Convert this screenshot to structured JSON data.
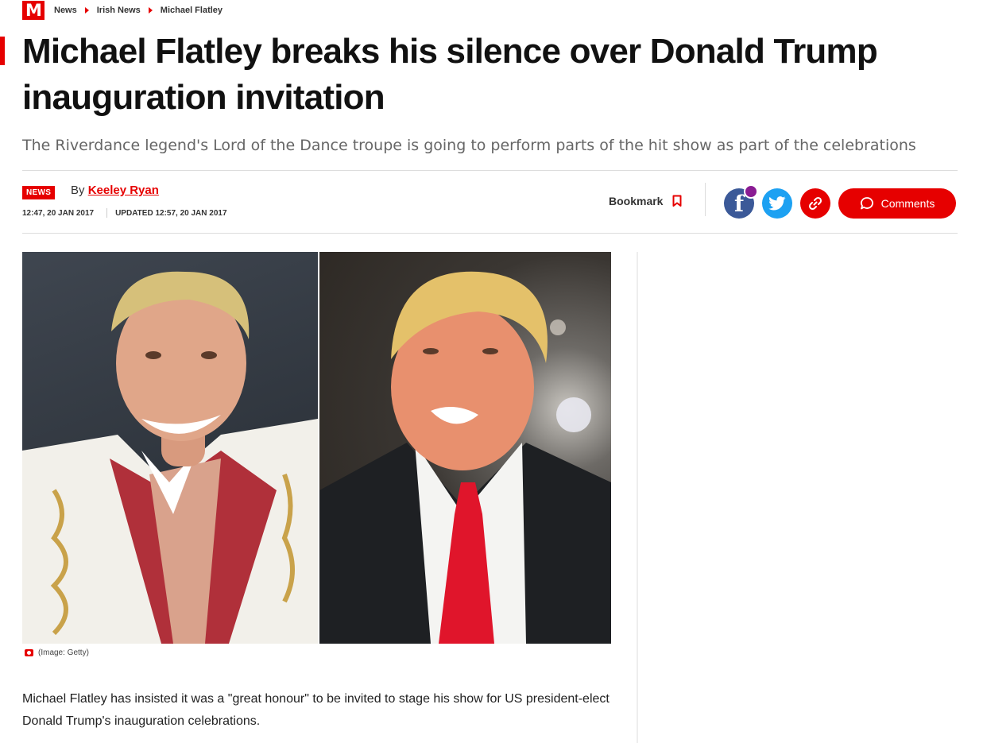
{
  "brand": {
    "logo_text": "M",
    "accent": "#e60000"
  },
  "breadcrumb": [
    "News",
    "Irish News",
    "Michael Flatley"
  ],
  "article": {
    "headline": "Michael Flatley breaks his silence over Donald Trump inauguration invitation",
    "standfirst": "The Riverdance legend's Lord of the Dance troupe is going to perform parts of the hit show as part of the celebrations",
    "section_badge": "NEWS",
    "byline_prefix": "By",
    "author": "Keeley Ryan",
    "published": "12:47, 20 JAN 2017",
    "updated": "UPDATED 12:57, 20 JAN 2017",
    "image_caption": "(Image: Getty)",
    "body": "Michael Flatley has insisted it was a \"great honour\" to be invited to stage his show for US president-elect Donald Trump's inauguration celebrations."
  },
  "actions": {
    "bookmark_label": "Bookmark",
    "comments_label": "Comments",
    "share_icons": [
      "facebook-icon",
      "twitter-icon",
      "link-icon"
    ]
  },
  "colors": {
    "facebook": "#3b5998",
    "twitter": "#1da1f2",
    "red": "#e60000"
  }
}
